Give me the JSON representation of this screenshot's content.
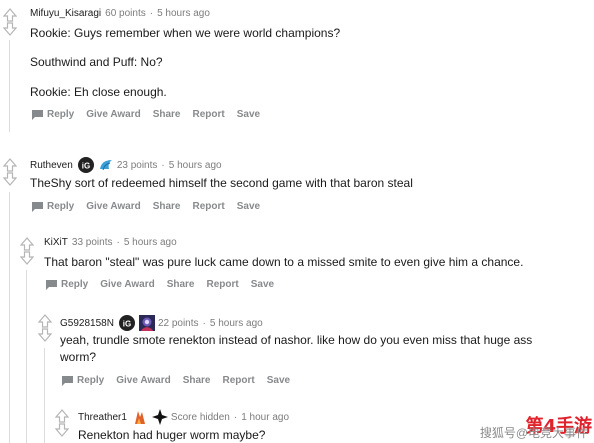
{
  "colors": {
    "meta": "#7c7c7c",
    "action": "#878a8c",
    "thread": "#dcdcdc",
    "brand_red": "#e0222b"
  },
  "icons": {
    "upvote": "up-arrow-icon",
    "downvote": "down-arrow-icon",
    "reply": "chat-bubble-icon"
  },
  "comments": [
    {
      "user": "Mifuyu_Kisaragi",
      "points": "60 points",
      "dot": "·",
      "time": "5 hours ago",
      "lines": [
        "Rookie: Guys remember when we were world champions?",
        "Southwind and Puff: No?",
        "Rookie: Eh close enough."
      ]
    },
    {
      "user": "Rutheven",
      "points": "23 points",
      "dot": "·",
      "time": "5 hours ago",
      "lines": [
        "TheShy sort of redeemed himself the second game with that baron steal"
      ]
    },
    {
      "user": "KiXiT",
      "points": "33 points",
      "dot": "·",
      "time": "5 hours ago",
      "lines": [
        "That baron \"steal\" was pure luck came down to a missed smite to even give him a chance."
      ]
    },
    {
      "user": "G5928158N",
      "points": "22 points",
      "dot": "·",
      "time": "5 hours ago",
      "lines": [
        "yeah, trundle smote renekton instead of nashor. like how do you even miss that huge ass",
        "worm?"
      ]
    },
    {
      "user": "Threather1",
      "points": "Score hidden",
      "dot": "·",
      "time": "1 hour ago",
      "lines": [
        "Renekton had huger worm maybe?"
      ]
    }
  ],
  "actions": {
    "reply": "Reply",
    "award": "Give Award",
    "share": "Share",
    "report": "Report",
    "save": "Save"
  },
  "watermark": {
    "text": "搜狐号@电竞大事件",
    "logo": "第4手游"
  }
}
